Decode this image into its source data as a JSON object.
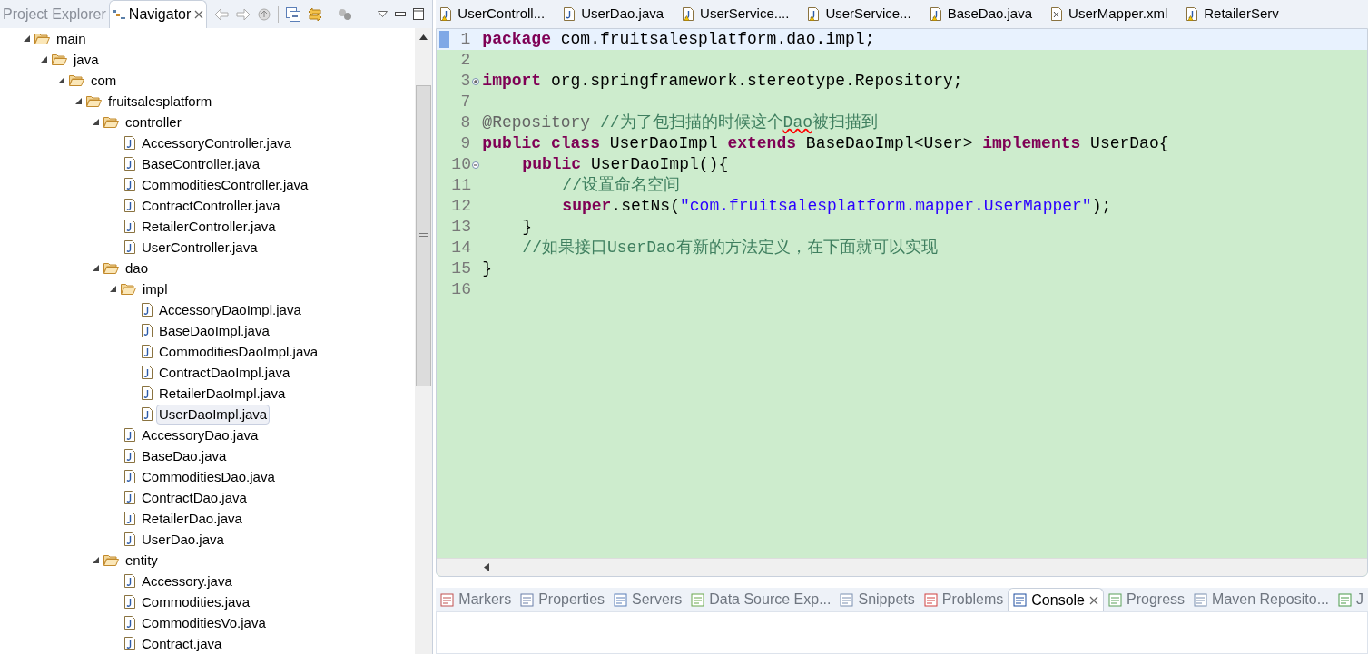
{
  "left_panel": {
    "tabs": [
      {
        "label": "Project Explorer",
        "selected": false,
        "closable": false
      },
      {
        "label": "Navigator",
        "selected": true,
        "closable": true
      }
    ],
    "tree": [
      {
        "label": "main",
        "kind": "folder",
        "expanded": true,
        "selected": false,
        "children": [
          {
            "label": "java",
            "kind": "folder",
            "expanded": true,
            "selected": false,
            "children": [
              {
                "label": "com",
                "kind": "folder",
                "expanded": true,
                "selected": false,
                "children": [
                  {
                    "label": "fruitsalesplatform",
                    "kind": "folder",
                    "expanded": true,
                    "selected": false,
                    "children": [
                      {
                        "label": "controller",
                        "kind": "folder",
                        "expanded": true,
                        "selected": false,
                        "children": [
                          {
                            "label": "AccessoryController.java",
                            "kind": "file",
                            "selected": false
                          },
                          {
                            "label": "BaseController.java",
                            "kind": "file",
                            "selected": false
                          },
                          {
                            "label": "CommoditiesController.java",
                            "kind": "file",
                            "selected": false
                          },
                          {
                            "label": "ContractController.java",
                            "kind": "file",
                            "selected": false
                          },
                          {
                            "label": "RetailerController.java",
                            "kind": "file",
                            "selected": false
                          },
                          {
                            "label": "UserController.java",
                            "kind": "file",
                            "selected": false
                          }
                        ]
                      },
                      {
                        "label": "dao",
                        "kind": "folder",
                        "expanded": true,
                        "selected": false,
                        "children": [
                          {
                            "label": "impl",
                            "kind": "folder",
                            "expanded": true,
                            "selected": false,
                            "children": [
                              {
                                "label": "AccessoryDaoImpl.java",
                                "kind": "file",
                                "selected": false
                              },
                              {
                                "label": "BaseDaoImpl.java",
                                "kind": "file",
                                "selected": false
                              },
                              {
                                "label": "CommoditiesDaoImpl.java",
                                "kind": "file",
                                "selected": false
                              },
                              {
                                "label": "ContractDaoImpl.java",
                                "kind": "file",
                                "selected": false
                              },
                              {
                                "label": "RetailerDaoImpl.java",
                                "kind": "file",
                                "selected": false
                              },
                              {
                                "label": "UserDaoImpl.java",
                                "kind": "file",
                                "selected": true
                              }
                            ]
                          },
                          {
                            "label": "AccessoryDao.java",
                            "kind": "file",
                            "selected": false
                          },
                          {
                            "label": "BaseDao.java",
                            "kind": "file",
                            "selected": false
                          },
                          {
                            "label": "CommoditiesDao.java",
                            "kind": "file",
                            "selected": false
                          },
                          {
                            "label": "ContractDao.java",
                            "kind": "file",
                            "selected": false
                          },
                          {
                            "label": "RetailerDao.java",
                            "kind": "file",
                            "selected": false
                          },
                          {
                            "label": "UserDao.java",
                            "kind": "file",
                            "selected": false
                          }
                        ]
                      },
                      {
                        "label": "entity",
                        "kind": "folder",
                        "expanded": true,
                        "selected": false,
                        "children": [
                          {
                            "label": "Accessory.java",
                            "kind": "file",
                            "selected": false
                          },
                          {
                            "label": "Commodities.java",
                            "kind": "file",
                            "selected": false
                          },
                          {
                            "label": "CommoditiesVo.java",
                            "kind": "file",
                            "selected": false
                          },
                          {
                            "label": "Contract.java",
                            "kind": "file",
                            "selected": false
                          }
                        ]
                      }
                    ]
                  }
                ]
              }
            ]
          }
        ]
      }
    ]
  },
  "editor": {
    "tabs": [
      {
        "label": "UserControll...",
        "kind": "java",
        "warning": true
      },
      {
        "label": "UserDao.java",
        "kind": "java",
        "warning": false
      },
      {
        "label": "UserService....",
        "kind": "java",
        "warning": true
      },
      {
        "label": "UserService...",
        "kind": "java",
        "warning": true
      },
      {
        "label": "BaseDao.java",
        "kind": "java",
        "warning": true
      },
      {
        "label": "UserMapper.xml",
        "kind": "xml",
        "warning": false
      },
      {
        "label": "RetailerServ",
        "kind": "java",
        "warning": true
      }
    ],
    "lines": [
      {
        "number": "1",
        "current": true,
        "kind": "top",
        "tokens": [
          {
            "kind": "keyword",
            "text": "package"
          },
          {
            "kind": "plain",
            "text": " com.fruitsalesplatform.dao.impl;"
          }
        ]
      },
      {
        "number": "2",
        "current": false
      },
      {
        "number": "3",
        "current": false,
        "collapsed": true,
        "kind": "top",
        "tokens": [
          {
            "kind": "keyword",
            "text": "import"
          },
          {
            "kind": "plain",
            "text": " org.springframework.stereotype.Repository;"
          }
        ]
      },
      {
        "number": "7",
        "current": false
      },
      {
        "number": "8",
        "current": false,
        "kind": "top",
        "tokens": [
          {
            "kind": "annotation",
            "text": "@Repository "
          },
          {
            "kind": "comment",
            "text": "//为了包扫描的时候这个"
          },
          {
            "kind": "misspelled",
            "text": "Dao"
          },
          {
            "kind": "comment",
            "text": "被扫描到"
          }
        ]
      },
      {
        "number": "9",
        "current": false,
        "kind": "top",
        "tokens": [
          {
            "kind": "keyword",
            "text": "public class"
          },
          {
            "kind": "plain",
            "text": " UserDaoImpl "
          },
          {
            "kind": "keyword",
            "text": "extends"
          },
          {
            "kind": "plain",
            "text": " BaseDaoImpl<User> "
          },
          {
            "kind": "keyword",
            "text": "implements"
          },
          {
            "kind": "plain",
            "text": " UserDao{"
          }
        ]
      },
      {
        "number": "10",
        "current": false,
        "collapsed": false,
        "kind": "member",
        "tokens": [
          {
            "kind": "keyword",
            "text": "public"
          },
          {
            "kind": "plain",
            "text": " UserDaoImpl(){"
          }
        ]
      },
      {
        "number": "11",
        "current": false,
        "kind": "body",
        "tokens": [
          {
            "kind": "comment",
            "text": "//设置命名空间"
          }
        ]
      },
      {
        "number": "12",
        "current": false,
        "kind": "body",
        "tokens": [
          {
            "kind": "keyword",
            "text": "super"
          },
          {
            "kind": "plain",
            "text": ".setNs("
          },
          {
            "kind": "string",
            "text": "\"com.fruitsalesplatform.mapper.UserMapper\""
          },
          {
            "kind": "plain",
            "text": ");"
          }
        ]
      },
      {
        "number": "13",
        "current": false,
        "kind": "member",
        "tokens": [
          {
            "kind": "plain",
            "text": "}"
          }
        ]
      },
      {
        "number": "14",
        "current": false,
        "kind": "member",
        "tokens": [
          {
            "kind": "comment",
            "text": "//如果接口UserDao有新的方法定义，在下面就可以实现"
          }
        ]
      },
      {
        "number": "15",
        "current": false,
        "kind": "top",
        "tokens": [
          {
            "kind": "plain",
            "text": "}"
          }
        ]
      },
      {
        "number": "16",
        "current": false
      }
    ]
  },
  "bottom_panel": {
    "tabs": [
      {
        "label": "Markers",
        "selected": false
      },
      {
        "label": "Properties",
        "selected": false
      },
      {
        "label": "Servers",
        "selected": false
      },
      {
        "label": "Data Source Exp...",
        "selected": false
      },
      {
        "label": "Snippets",
        "selected": false
      },
      {
        "label": "Problems",
        "selected": false
      },
      {
        "label": "Console",
        "selected": true
      },
      {
        "label": "Progress",
        "selected": false
      },
      {
        "label": "Maven Reposito...",
        "selected": false
      },
      {
        "label": "J",
        "selected": false
      }
    ]
  }
}
